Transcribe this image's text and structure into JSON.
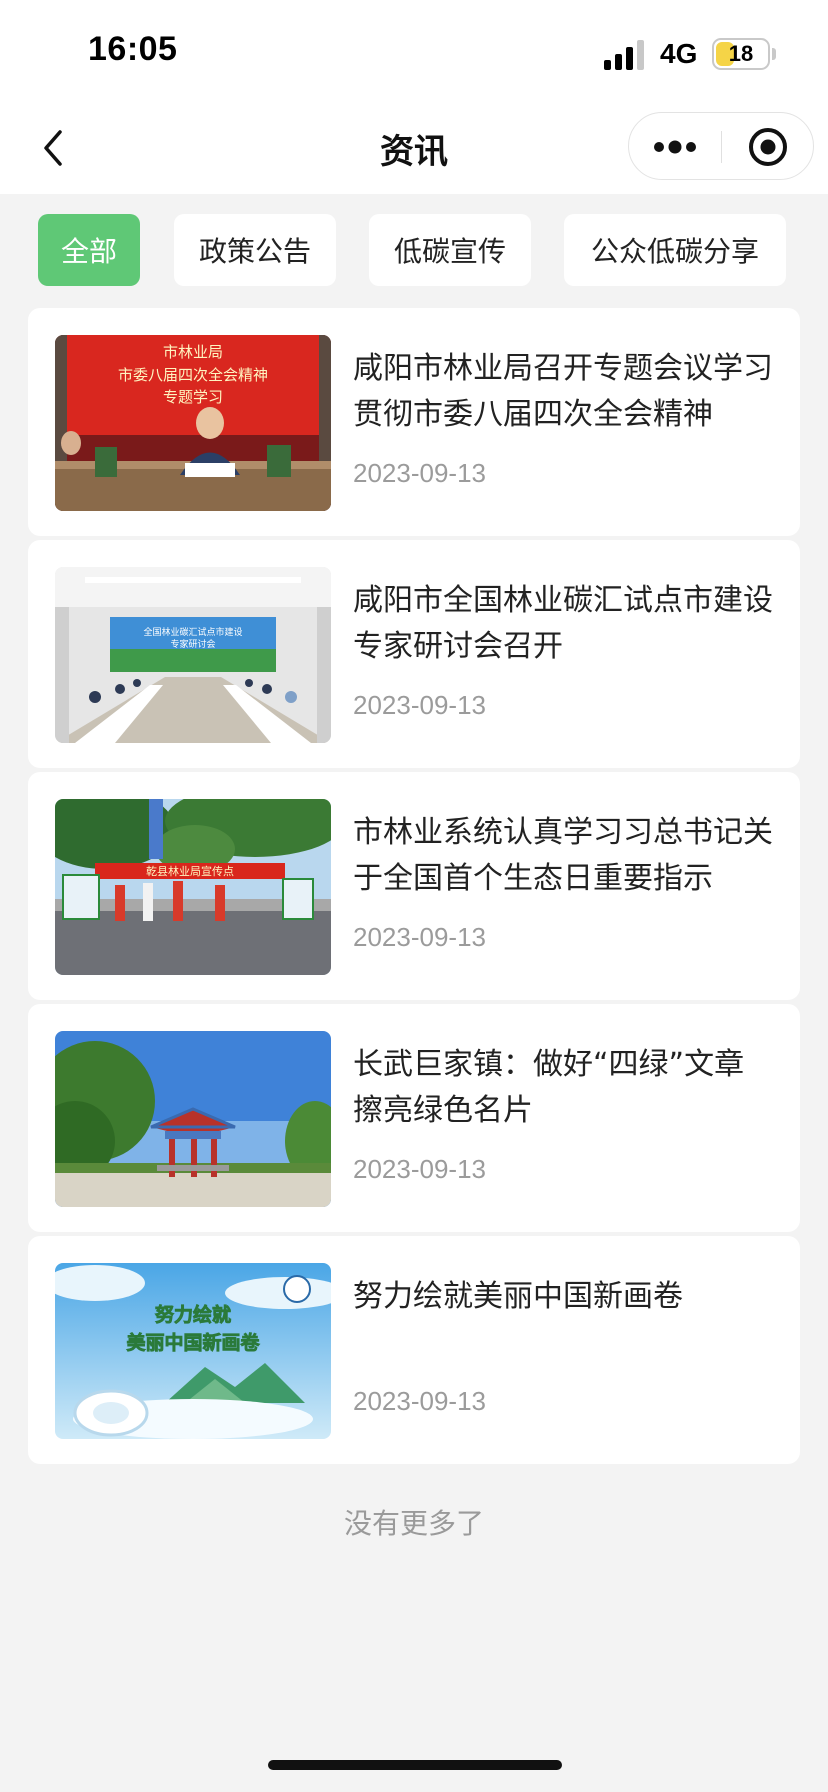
{
  "status_bar": {
    "time": "16:05",
    "network": "4G",
    "battery_level": "18",
    "battery_fraction": 0.35,
    "icons": [
      "signal-icon",
      "battery-icon"
    ]
  },
  "nav": {
    "title": "资讯",
    "icons": [
      "back-chevron-icon",
      "more-dots-icon",
      "close-target-icon"
    ]
  },
  "tabs": [
    {
      "label": "全部",
      "active": true
    },
    {
      "label": "政策公告",
      "active": false
    },
    {
      "label": "低碳宣传",
      "active": false
    },
    {
      "label": "公众低碳分享",
      "active": false
    }
  ],
  "articles": [
    {
      "title": "咸阳市林业局召开专题会议学习贯彻市委八届四次全会精神",
      "date": "2023-09-13"
    },
    {
      "title": "咸阳市全国林业碳汇试点市建设专家研讨会召开",
      "date": "2023-09-13"
    },
    {
      "title": "市林业系统认真学习习总书记关于全国首个生态日重要指示",
      "date": "2023-09-13"
    },
    {
      "title": "长武巨家镇：做好“四绿”文章 擦亮绿色名片",
      "date": "2023-09-13"
    },
    {
      "title": "努力绘就美丽中国新画卷",
      "date": "2023-09-13"
    }
  ],
  "thumbnails": {
    "t1": {
      "line1": "市林业局",
      "line2": "市委八届四次全会精神",
      "line3": "专题学习"
    },
    "t2": {
      "line1": "全国林业碳汇试点市建设",
      "line2": "专家研讨会"
    },
    "t3": {
      "line1": "乾县林业局宣传点"
    },
    "t5": {
      "line1": "努力绘就",
      "line2": "美丽中国新画卷"
    }
  },
  "footer": {
    "no_more": "没有更多了"
  },
  "colors": {
    "accent_green": "#5fc876",
    "background": "#f3f3f3",
    "date_gray": "#9b9b9b"
  }
}
